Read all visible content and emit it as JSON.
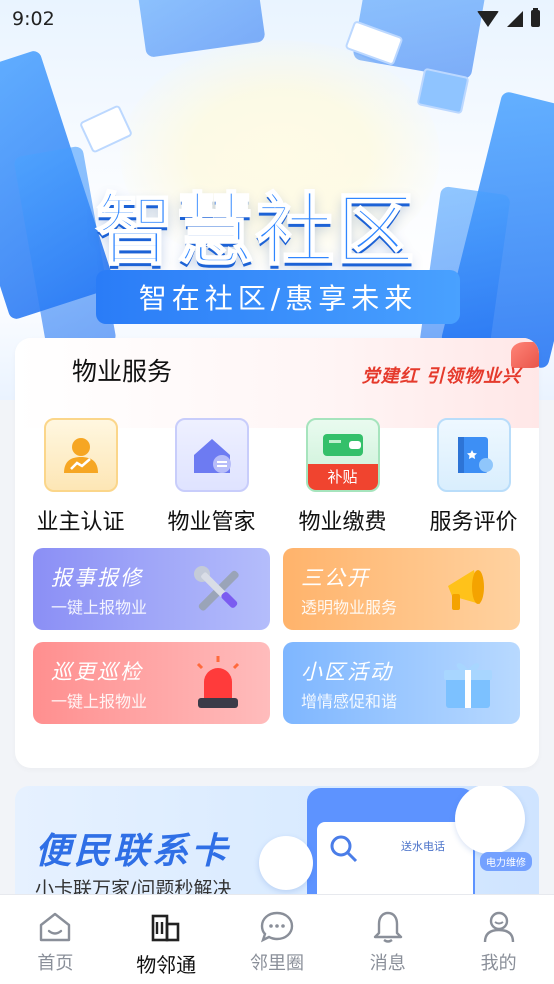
{
  "status_bar": {
    "time": "9:02"
  },
  "hero": {
    "title": "智慧社区",
    "subtitle": "智在社区/惠享未来"
  },
  "property_services": {
    "title": "物业服务",
    "slogan": "党建红 引领物业兴",
    "items": [
      {
        "label": "业主认证",
        "icon": "owner-verify-icon"
      },
      {
        "label": "物业管家",
        "icon": "home-butler-icon"
      },
      {
        "label": "物业缴费",
        "icon": "wallet-subsidy-icon",
        "badge": "补贴"
      },
      {
        "label": "服务评价",
        "icon": "review-book-icon"
      }
    ],
    "tiles": [
      {
        "title": "报事报修",
        "subtitle": "一键上报物业",
        "icon": "wrench-screwdriver-icon"
      },
      {
        "title": "三公开",
        "subtitle": "透明物业服务",
        "icon": "megaphone-icon"
      },
      {
        "title": "巡更巡检",
        "subtitle": "一键上报物业",
        "icon": "alarm-light-icon"
      },
      {
        "title": "小区活动",
        "subtitle": "增情感促和谐",
        "icon": "gift-box-icon"
      }
    ]
  },
  "banner": {
    "title": "便民联系卡",
    "subtitle": "小卡联万家/问题秒解决",
    "chip_water": "送水电话",
    "chip_power": "电力维修"
  },
  "bottom_nav": {
    "items": [
      {
        "label": "首页",
        "icon": "home-icon",
        "active": false
      },
      {
        "label": "物邻通",
        "icon": "building-icon",
        "active": true
      },
      {
        "label": "邻里圈",
        "icon": "chat-bubble-icon",
        "active": false
      },
      {
        "label": "消息",
        "icon": "bell-icon",
        "active": false
      },
      {
        "label": "我的",
        "icon": "user-icon",
        "active": false
      }
    ]
  },
  "colors": {
    "accent": "#2f86ff",
    "party_red": "#e53a2c"
  }
}
